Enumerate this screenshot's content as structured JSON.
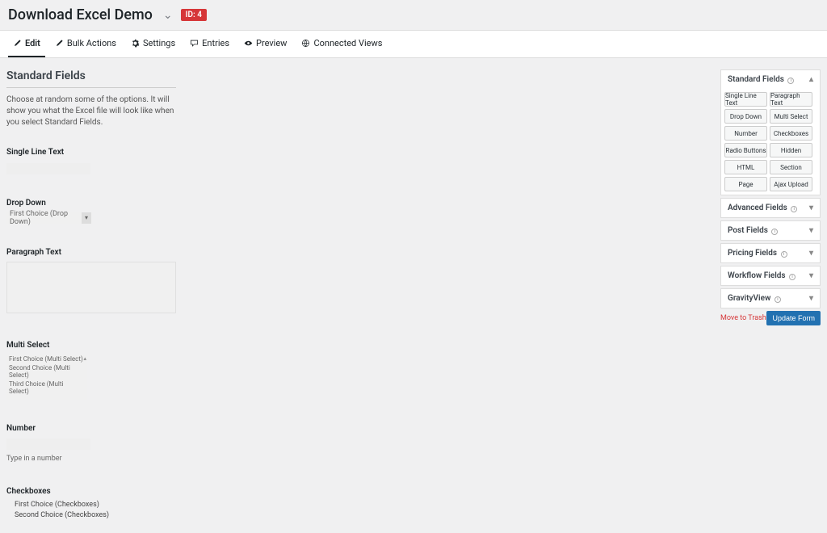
{
  "header": {
    "title": "Download Excel Demo",
    "id_badge": "ID: 4"
  },
  "tabs": [
    {
      "label": "Edit",
      "active": true
    },
    {
      "label": "Bulk Actions",
      "active": false
    },
    {
      "label": "Settings",
      "active": false
    },
    {
      "label": "Entries",
      "active": false
    },
    {
      "label": "Preview",
      "active": false
    },
    {
      "label": "Connected Views",
      "active": false
    }
  ],
  "form": {
    "heading": "Standard Fields",
    "description": "Choose at random some of the options. It will show you what the Excel file will look like when you select Standard Fields.",
    "fields": {
      "single_line": {
        "label": "Single Line Text"
      },
      "drop_down": {
        "label": "Drop Down",
        "selected": "First Choice (Drop Down)"
      },
      "paragraph": {
        "label": "Paragraph Text"
      },
      "multi_select": {
        "label": "Multi Select",
        "options": [
          "First Choice (Multi Select)",
          "Second Choice (Multi Select)",
          "Third Choice (Multi Select)"
        ]
      },
      "number": {
        "label": "Number",
        "hint": "Type in a number"
      },
      "checkboxes": {
        "label": "Checkboxes",
        "options": [
          "First Choice (Checkboxes)",
          "Second Choice (Checkboxes)"
        ]
      }
    }
  },
  "sidebar": {
    "panels": {
      "standard": {
        "title": "Standard Fields",
        "open": true,
        "fields": [
          "Single Line Text",
          "Paragraph Text",
          "Drop Down",
          "Multi Select",
          "Number",
          "Checkboxes",
          "Radio Buttons",
          "Hidden",
          "HTML",
          "Section",
          "Page",
          "Ajax Upload"
        ]
      },
      "advanced": {
        "title": "Advanced Fields"
      },
      "post": {
        "title": "Post Fields"
      },
      "pricing": {
        "title": "Pricing Fields"
      },
      "workflow": {
        "title": "Workflow Fields"
      },
      "gravityview": {
        "title": "GravityView"
      }
    },
    "actions": {
      "trash": "Move to Trash",
      "update": "Update Form"
    }
  }
}
